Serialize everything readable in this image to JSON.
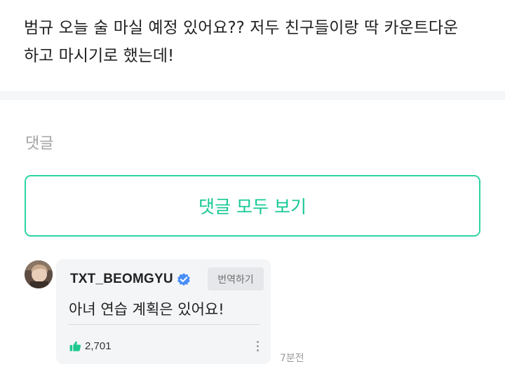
{
  "post": {
    "text": "범규 오늘 술 마실 예정 있어요?? 저두 친구들이랑 딱 카운트다운\n하고 마시기로 했는데!"
  },
  "comments_section": {
    "heading": "댓글",
    "view_all_label": "댓글 모두 보기"
  },
  "comment": {
    "author": "TXT_BEOMGYU",
    "verified_icon": "verified-badge-icon",
    "translate_label": "번역하기",
    "text": "아녀 연습 계획은 있어요!",
    "like_icon": "thumbs-up-icon",
    "like_count": "2,701",
    "more_icon": "vertical-ellipsis-icon",
    "timestamp": "7분전"
  },
  "colors": {
    "accent": "#16c894",
    "button_border": "#2ed3a3",
    "verified_blue": "#4a8ff7",
    "like_green": "#1fc98e",
    "bubble_bg": "#f4f5f7"
  }
}
